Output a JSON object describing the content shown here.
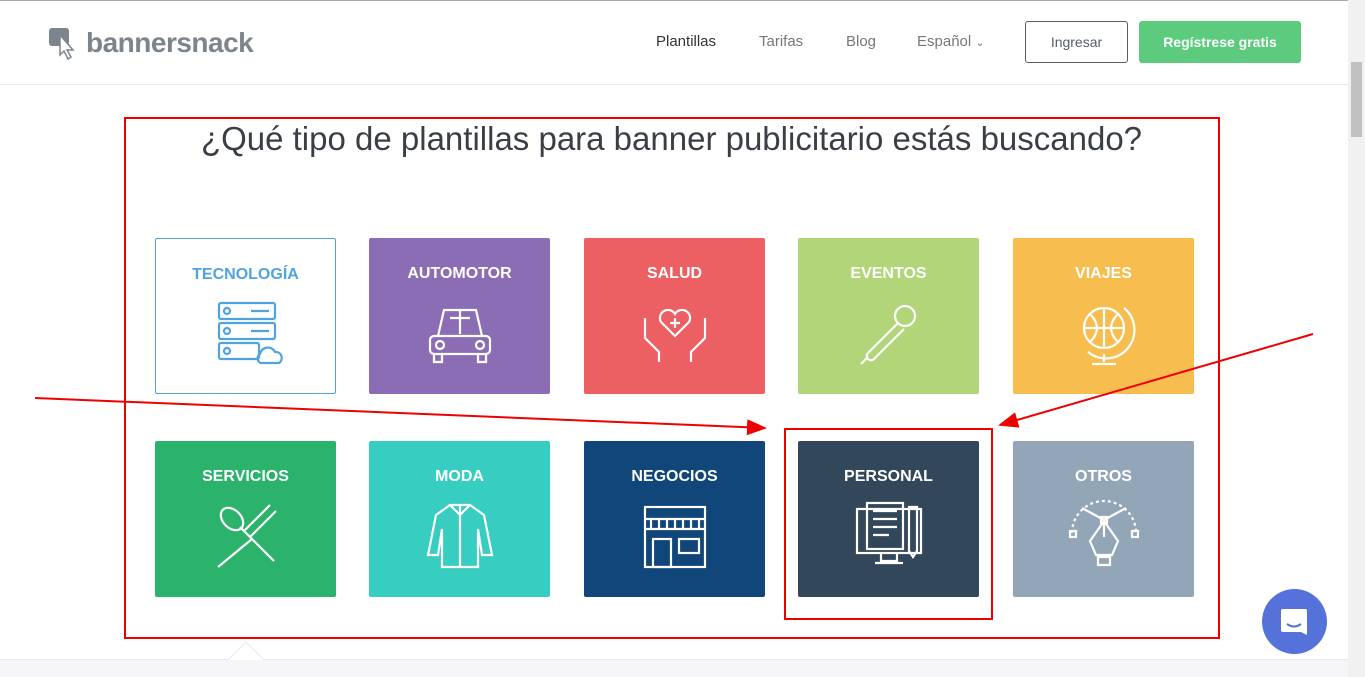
{
  "header": {
    "logo": "bannersnack",
    "nav": [
      "Plantillas",
      "Tarifas",
      "Blog",
      "Español"
    ],
    "login": "Ingresar",
    "register": "Regístrese gratis"
  },
  "title": "¿Qué tipo de plantillas para banner publicitario estás buscando?",
  "tiles": [
    {
      "label": "TECNOLOGÍA",
      "color": "#ffffff",
      "icon": "server-cloud-icon"
    },
    {
      "label": "AUTOMOTOR",
      "color": "#8a6db5",
      "icon": "car-icon"
    },
    {
      "label": "SALUD",
      "color": "#ec5f62",
      "icon": "heart-hands-icon"
    },
    {
      "label": "EVENTOS",
      "color": "#b2d57a",
      "icon": "microphone-icon"
    },
    {
      "label": "VIAJES",
      "color": "#f8bd4f",
      "icon": "globe-icon"
    },
    {
      "label": "SERVICIOS",
      "color": "#2bb36b",
      "icon": "spoon-fork-icon"
    },
    {
      "label": "MODA",
      "color": "#38cdc1",
      "icon": "jacket-icon"
    },
    {
      "label": "NEGOCIOS",
      "color": "#10467a",
      "icon": "shop-icon"
    },
    {
      "label": "PERSONAL",
      "color": "#33475b",
      "icon": "desktop-document-icon"
    },
    {
      "label": "OTROS",
      "color": "#92a6b7",
      "icon": "pen-tool-icon"
    }
  ]
}
